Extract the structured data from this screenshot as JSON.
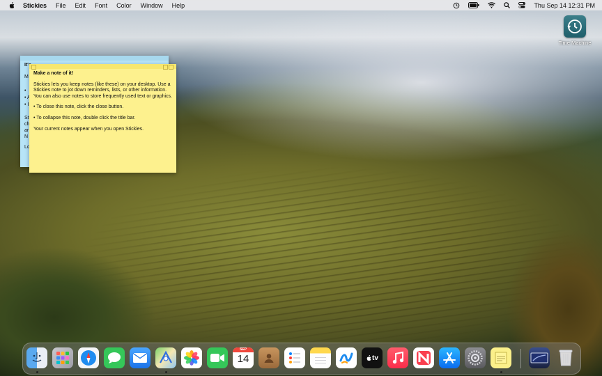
{
  "menubar": {
    "app_name": "Stickies",
    "menus": [
      "File",
      "Edit",
      "Font",
      "Color",
      "Window",
      "Help"
    ],
    "clock": "Thu Sep 14  12:31 PM"
  },
  "desktop": {
    "time_machine_label": "Time Machine"
  },
  "blue_note": {
    "title_fragment": "It's",
    "fragments": [
      "M",
      "•",
      "• A",
      "• I",
      "St",
      "ch",
      "ar",
      "N",
      "Lo"
    ]
  },
  "yellow_note": {
    "title": "Make a note of it!",
    "para1": "Stickies lets you keep notes (like these) on your desktop. Use a Stickies note to jot down reminders, lists, or other information. You can also use notes to store frequently used text or graphics.",
    "para2": "• To close this note, click the close button.",
    "para3": "• To collapse this note, double click the title bar.",
    "para4": "Your current notes appear when you open Stickies."
  },
  "dock": {
    "calendar_month": "SEP",
    "calendar_day": "14",
    "tv_label": "tv"
  }
}
